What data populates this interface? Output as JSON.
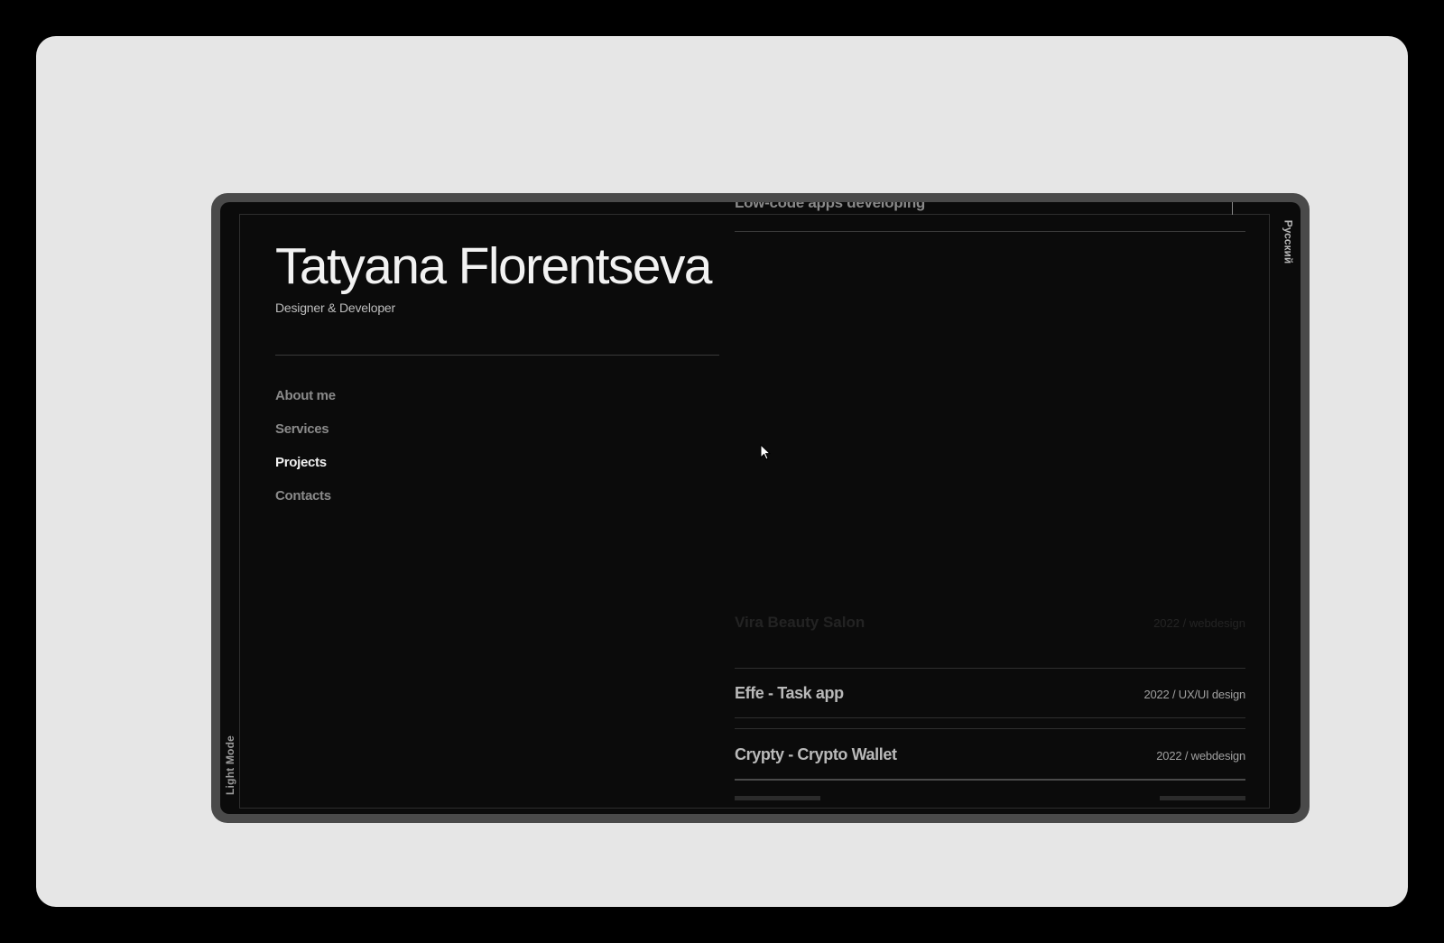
{
  "site": {
    "name": "Tatyana Florentseva",
    "tagline": "Designer & Developer"
  },
  "nav": {
    "items": [
      {
        "label": "About me"
      },
      {
        "label": "Services"
      },
      {
        "label": "Projects"
      },
      {
        "label": "Contacts"
      }
    ],
    "active": "Projects"
  },
  "toggles": {
    "theme_label": "Light Mode",
    "language_label": "Русский"
  },
  "projects": {
    "top_partial_title": "Low-code apps developing",
    "faded": {
      "title": "Vira Beauty Salon",
      "meta": "2022 / webdesign"
    },
    "rows": [
      {
        "title": "Effe - Task app",
        "meta": "2022 / UX/UI design"
      },
      {
        "title": "Crypty - Crypto Wallet",
        "meta": "2022 / webdesign"
      }
    ]
  },
  "colors": {
    "page_background": "#000000",
    "card_background": "#e6e6e6",
    "device_bezel": "#4a4a4a",
    "screen_background": "#0b0b0b",
    "text_primary": "#f2f2f2",
    "text_muted": "#8a8a8a"
  },
  "icons": {
    "pointer": "cursor-arrow-icon"
  }
}
